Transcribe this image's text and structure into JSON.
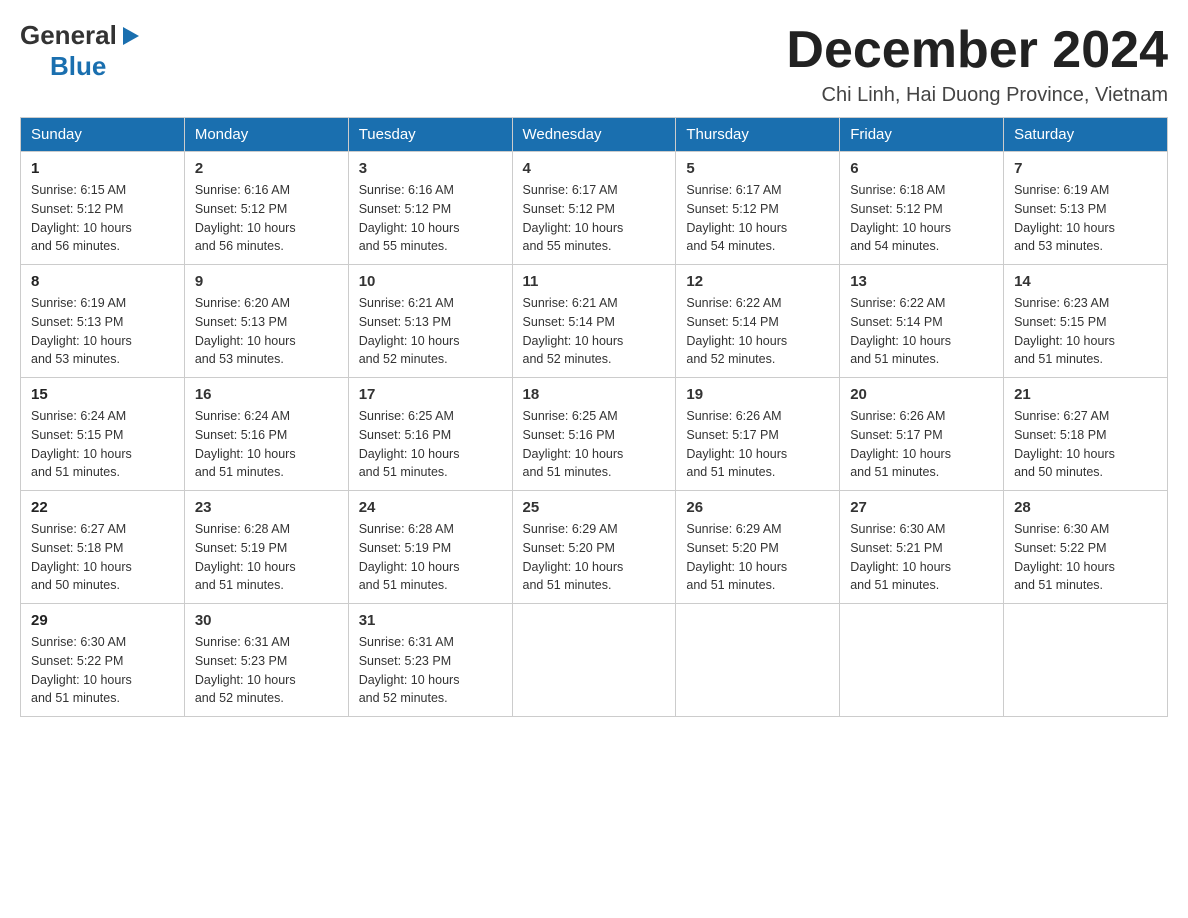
{
  "header": {
    "month_title": "December 2024",
    "location": "Chi Linh, Hai Duong Province, Vietnam",
    "logo_general": "General",
    "logo_blue": "Blue"
  },
  "weekdays": [
    "Sunday",
    "Monday",
    "Tuesday",
    "Wednesday",
    "Thursday",
    "Friday",
    "Saturday"
  ],
  "weeks": [
    [
      {
        "day": "1",
        "sunrise": "6:15 AM",
        "sunset": "5:12 PM",
        "daylight": "10 hours and 56 minutes."
      },
      {
        "day": "2",
        "sunrise": "6:16 AM",
        "sunset": "5:12 PM",
        "daylight": "10 hours and 56 minutes."
      },
      {
        "day": "3",
        "sunrise": "6:16 AM",
        "sunset": "5:12 PM",
        "daylight": "10 hours and 55 minutes."
      },
      {
        "day": "4",
        "sunrise": "6:17 AM",
        "sunset": "5:12 PM",
        "daylight": "10 hours and 55 minutes."
      },
      {
        "day": "5",
        "sunrise": "6:17 AM",
        "sunset": "5:12 PM",
        "daylight": "10 hours and 54 minutes."
      },
      {
        "day": "6",
        "sunrise": "6:18 AM",
        "sunset": "5:12 PM",
        "daylight": "10 hours and 54 minutes."
      },
      {
        "day": "7",
        "sunrise": "6:19 AM",
        "sunset": "5:13 PM",
        "daylight": "10 hours and 53 minutes."
      }
    ],
    [
      {
        "day": "8",
        "sunrise": "6:19 AM",
        "sunset": "5:13 PM",
        "daylight": "10 hours and 53 minutes."
      },
      {
        "day": "9",
        "sunrise": "6:20 AM",
        "sunset": "5:13 PM",
        "daylight": "10 hours and 53 minutes."
      },
      {
        "day": "10",
        "sunrise": "6:21 AM",
        "sunset": "5:13 PM",
        "daylight": "10 hours and 52 minutes."
      },
      {
        "day": "11",
        "sunrise": "6:21 AM",
        "sunset": "5:14 PM",
        "daylight": "10 hours and 52 minutes."
      },
      {
        "day": "12",
        "sunrise": "6:22 AM",
        "sunset": "5:14 PM",
        "daylight": "10 hours and 52 minutes."
      },
      {
        "day": "13",
        "sunrise": "6:22 AM",
        "sunset": "5:14 PM",
        "daylight": "10 hours and 51 minutes."
      },
      {
        "day": "14",
        "sunrise": "6:23 AM",
        "sunset": "5:15 PM",
        "daylight": "10 hours and 51 minutes."
      }
    ],
    [
      {
        "day": "15",
        "sunrise": "6:24 AM",
        "sunset": "5:15 PM",
        "daylight": "10 hours and 51 minutes."
      },
      {
        "day": "16",
        "sunrise": "6:24 AM",
        "sunset": "5:16 PM",
        "daylight": "10 hours and 51 minutes."
      },
      {
        "day": "17",
        "sunrise": "6:25 AM",
        "sunset": "5:16 PM",
        "daylight": "10 hours and 51 minutes."
      },
      {
        "day": "18",
        "sunrise": "6:25 AM",
        "sunset": "5:16 PM",
        "daylight": "10 hours and 51 minutes."
      },
      {
        "day": "19",
        "sunrise": "6:26 AM",
        "sunset": "5:17 PM",
        "daylight": "10 hours and 51 minutes."
      },
      {
        "day": "20",
        "sunrise": "6:26 AM",
        "sunset": "5:17 PM",
        "daylight": "10 hours and 51 minutes."
      },
      {
        "day": "21",
        "sunrise": "6:27 AM",
        "sunset": "5:18 PM",
        "daylight": "10 hours and 50 minutes."
      }
    ],
    [
      {
        "day": "22",
        "sunrise": "6:27 AM",
        "sunset": "5:18 PM",
        "daylight": "10 hours and 50 minutes."
      },
      {
        "day": "23",
        "sunrise": "6:28 AM",
        "sunset": "5:19 PM",
        "daylight": "10 hours and 51 minutes."
      },
      {
        "day": "24",
        "sunrise": "6:28 AM",
        "sunset": "5:19 PM",
        "daylight": "10 hours and 51 minutes."
      },
      {
        "day": "25",
        "sunrise": "6:29 AM",
        "sunset": "5:20 PM",
        "daylight": "10 hours and 51 minutes."
      },
      {
        "day": "26",
        "sunrise": "6:29 AM",
        "sunset": "5:20 PM",
        "daylight": "10 hours and 51 minutes."
      },
      {
        "day": "27",
        "sunrise": "6:30 AM",
        "sunset": "5:21 PM",
        "daylight": "10 hours and 51 minutes."
      },
      {
        "day": "28",
        "sunrise": "6:30 AM",
        "sunset": "5:22 PM",
        "daylight": "10 hours and 51 minutes."
      }
    ],
    [
      {
        "day": "29",
        "sunrise": "6:30 AM",
        "sunset": "5:22 PM",
        "daylight": "10 hours and 51 minutes."
      },
      {
        "day": "30",
        "sunrise": "6:31 AM",
        "sunset": "5:23 PM",
        "daylight": "10 hours and 52 minutes."
      },
      {
        "day": "31",
        "sunrise": "6:31 AM",
        "sunset": "5:23 PM",
        "daylight": "10 hours and 52 minutes."
      },
      null,
      null,
      null,
      null
    ]
  ],
  "labels": {
    "sunrise": "Sunrise:",
    "sunset": "Sunset:",
    "daylight": "Daylight:"
  }
}
